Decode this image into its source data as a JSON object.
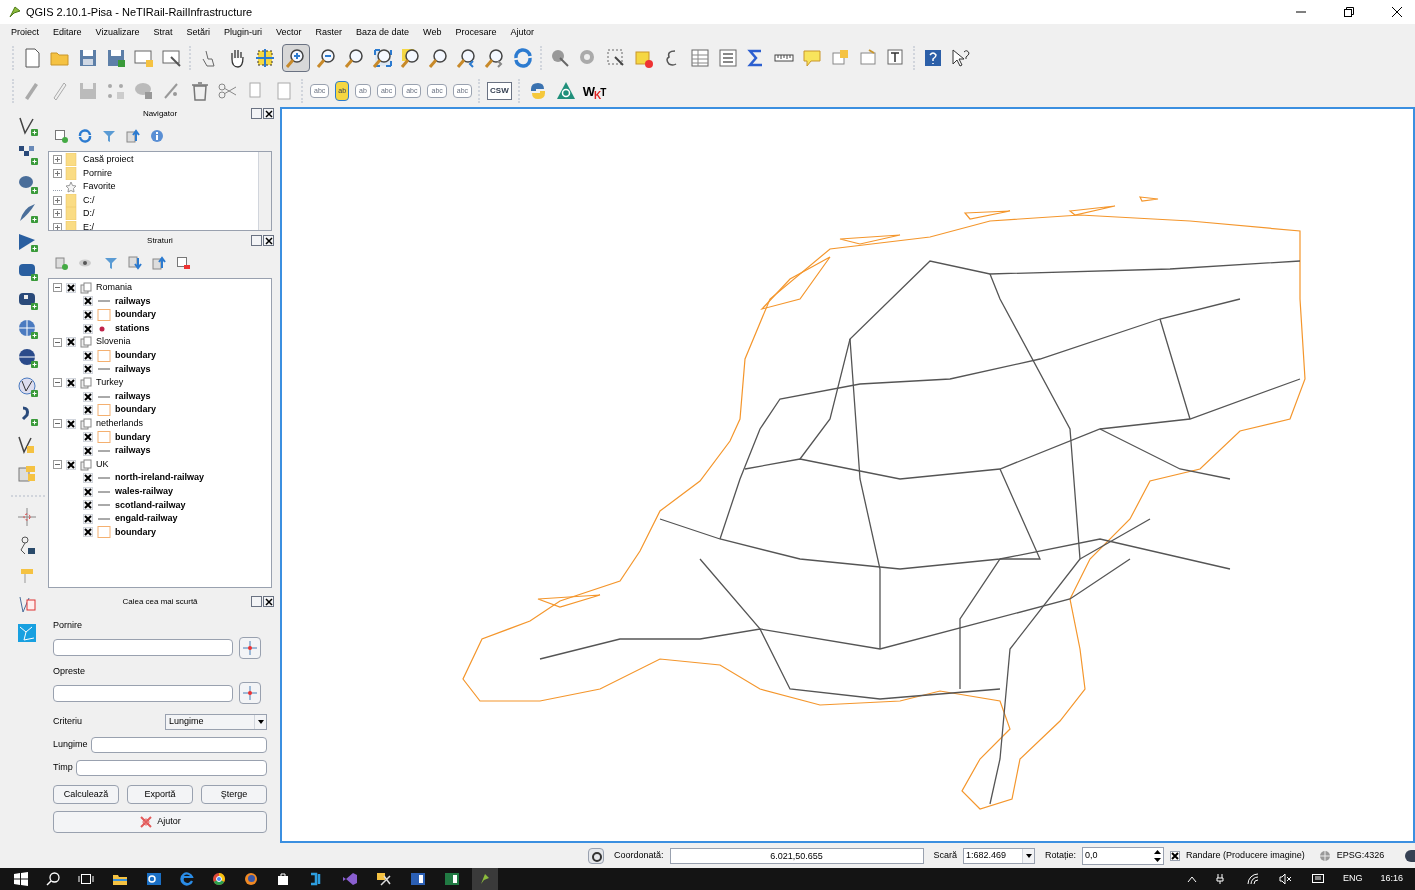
{
  "window": {
    "title": "QGIS 2.10.1-Pisa - NeTIRail-RailInfrastructure"
  },
  "menu": [
    "Proiect",
    "Editare",
    "Vizualizare",
    "Strat",
    "Setări",
    "Plugin-uri",
    "Vector",
    "Raster",
    "Baza de date",
    "Web",
    "Procesare",
    "Ajutor"
  ],
  "toolbar": {
    "zoom_in_pressed": true,
    "label_tool_texts": [
      "abc",
      "ab",
      "ab",
      "abc",
      "abc",
      "abc",
      "abc"
    ],
    "csw": "CSW",
    "wkt_letters": [
      "W",
      "K",
      "T"
    ]
  },
  "navigator": {
    "title": "Navigator",
    "items": [
      {
        "label": "Casă proiect",
        "kind": "folder",
        "expandable": true
      },
      {
        "label": "Pornire",
        "kind": "folder",
        "expandable": true
      },
      {
        "label": "Favorite",
        "kind": "favorites",
        "expandable": false
      },
      {
        "label": "C:/",
        "kind": "folder",
        "expandable": true
      },
      {
        "label": "D:/",
        "kind": "folder",
        "expandable": true
      },
      {
        "label": "E:/",
        "kind": "folder",
        "expandable": true
      }
    ]
  },
  "layers": {
    "title": "Straturi",
    "groups": [
      {
        "name": "Romania",
        "expanded": true,
        "checked": true,
        "children": [
          {
            "name": "railways",
            "kind": "line",
            "checked": true
          },
          {
            "name": "boundary",
            "kind": "polygon",
            "checked": true
          },
          {
            "name": "stations",
            "kind": "point",
            "checked": true
          }
        ]
      },
      {
        "name": "Slovenia",
        "expanded": true,
        "checked": true,
        "children": [
          {
            "name": "boundary",
            "kind": "polygon",
            "checked": true
          },
          {
            "name": "railways",
            "kind": "line",
            "checked": true
          }
        ]
      },
      {
        "name": "Turkey",
        "expanded": true,
        "checked": true,
        "children": [
          {
            "name": "railways",
            "kind": "line",
            "checked": true
          },
          {
            "name": "boundary",
            "kind": "polygon",
            "checked": true
          }
        ]
      },
      {
        "name": "netherlands",
        "expanded": true,
        "checked": true,
        "children": [
          {
            "name": "bundary",
            "kind": "polygon",
            "checked": true
          },
          {
            "name": "railways",
            "kind": "line",
            "checked": true
          }
        ]
      },
      {
        "name": "UK",
        "expanded": true,
        "checked": true,
        "children": [
          {
            "name": "north-ireland-railway",
            "kind": "line",
            "checked": true
          },
          {
            "name": "wales-railway",
            "kind": "line",
            "checked": true
          },
          {
            "name": "scotland-railway",
            "kind": "line",
            "checked": true
          },
          {
            "name": "engald-railway",
            "kind": "line",
            "checked": true
          },
          {
            "name": "boundary",
            "kind": "polygon",
            "checked": true
          }
        ]
      }
    ]
  },
  "shortest_path": {
    "title": "Calea cea mai scurtă",
    "start_label": "Pornire",
    "stop_label": "Opreste",
    "criterion_label": "Criteriu",
    "criterion_value": "Lungime",
    "length_label": "Lungime",
    "time_label": "Timp",
    "buttons": [
      "Calculează",
      "Exportă",
      "Şterge"
    ],
    "help_button": "Ajutor"
  },
  "status_bar": {
    "coordinate_label": "Coordonată:",
    "coordinate": "6.021,50.655",
    "scale_label": "Scară",
    "scale": "1:682.469",
    "rotation_label": "Rotație:",
    "rotation": "0,0",
    "render_label": "Randare (Producere imagine)",
    "render_checked": true,
    "crs": "EPSG:4326"
  },
  "taskbar": {
    "language": "ENG",
    "time": "16:16"
  }
}
